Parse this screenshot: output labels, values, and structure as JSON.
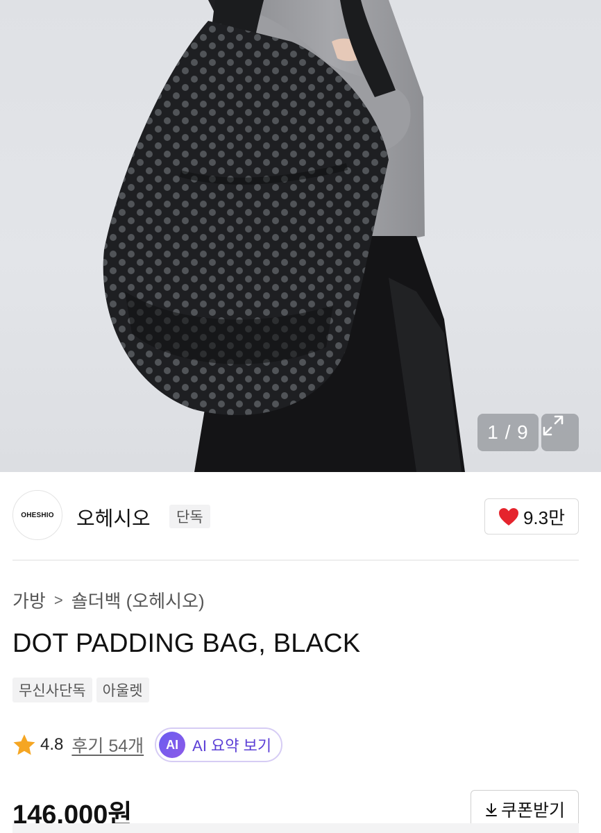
{
  "gallery": {
    "pager_text": "1 / 9",
    "expand_icon": "expand-icon"
  },
  "brand": {
    "logo_text": "OHESHIO",
    "name": "오헤시오",
    "badge": "단독",
    "like_count": "9.3만",
    "like_icon": "heart-icon",
    "like_color": "#e5242d"
  },
  "breadcrumb": {
    "items": [
      "가방",
      "숄더백 (오헤시오)"
    ],
    "separator": ">"
  },
  "product": {
    "title": "DOT PADDING BAG, BLACK",
    "tags": [
      "무신사단독",
      "아울렛"
    ]
  },
  "rating": {
    "value": "4.8",
    "star_color": "#f5a623",
    "review_link": "후기 54개",
    "ai_badge": "AI",
    "ai_button": "AI 요약 보기",
    "ai_color": "#6b5cf0"
  },
  "price": {
    "amount": "146,000원",
    "coupon_button": "쿠폰받기",
    "coupon_icon": "download-icon"
  }
}
